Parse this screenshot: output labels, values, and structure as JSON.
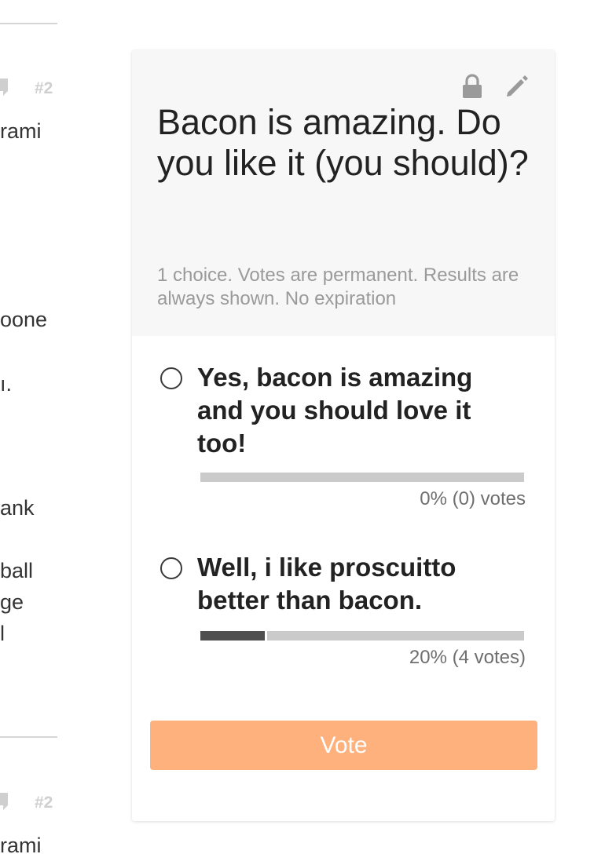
{
  "thread": {
    "post_number_top": "#2",
    "post_number_bottom": "#2",
    "snippets": [
      "rami",
      "oone",
      "ı.",
      "ank",
      "ball",
      "ge",
      "l",
      "rami"
    ]
  },
  "poll": {
    "title": "Bacon is amazing. Do you like it (you should)?",
    "meta": "1 choice. Votes are permanent. Results are always shown. No expiration",
    "options": [
      {
        "label": "Yes, bacon is amazing and you should love it too!",
        "percent": 0,
        "votes_text": "0% (0) votes"
      },
      {
        "label": "Well, i like proscuitto better than bacon.",
        "percent": 20,
        "votes_text": "20% (4 votes)"
      }
    ],
    "vote_label": "Vote",
    "colors": {
      "header_bg": "#f7f7f7",
      "vote_button": "#feb17c",
      "bar_fill": "#4f4f4f",
      "bar_track": "#cacaca"
    }
  }
}
